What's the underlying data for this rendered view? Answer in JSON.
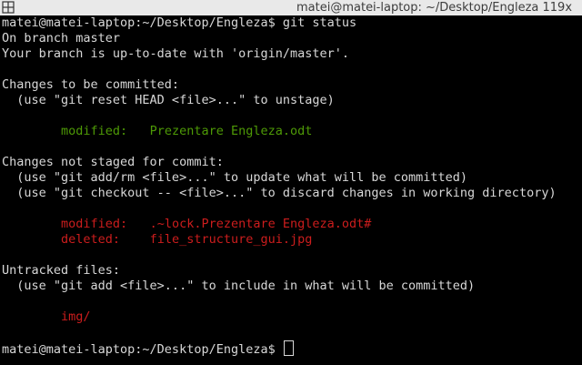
{
  "window": {
    "title": "matei@matei-laptop: ~/Desktop/Engleza 119x",
    "icon": "terminal-split-icon"
  },
  "terminal": {
    "command_line": "matei@matei-laptop:~/Desktop/Engleza$ git status",
    "branch_line": "On branch master",
    "uptodate_line": "Your branch is up-to-date with 'origin/master'.",
    "staged_header": "Changes to be committed:",
    "staged_hint": "  (use \"git reset HEAD <file>...\" to unstage)",
    "staged_files": [
      {
        "status": "modified:",
        "file": "Prezentare Engleza.odt"
      }
    ],
    "unstaged_header": "Changes not staged for commit:",
    "unstaged_hint1": "  (use \"git add/rm <file>...\" to update what will be committed)",
    "unstaged_hint2": "  (use \"git checkout -- <file>...\" to discard changes in working directory)",
    "unstaged_files": [
      {
        "status": "modified:",
        "file": ".~lock.Prezentare Engleza.odt#"
      },
      {
        "status": "deleted:",
        "file": "file_structure_gui.jpg"
      }
    ],
    "untracked_header": "Untracked files:",
    "untracked_hint": "  (use \"git add <file>...\" to include in what will be committed)",
    "untracked_files": [
      "img/"
    ],
    "prompt": "matei@matei-laptop:~/Desktop/Engleza$ "
  },
  "colors": {
    "background": "#000000",
    "foreground": "#d8d8d8",
    "staged": "#4e9a06",
    "unstaged": "#cc1d1d"
  }
}
